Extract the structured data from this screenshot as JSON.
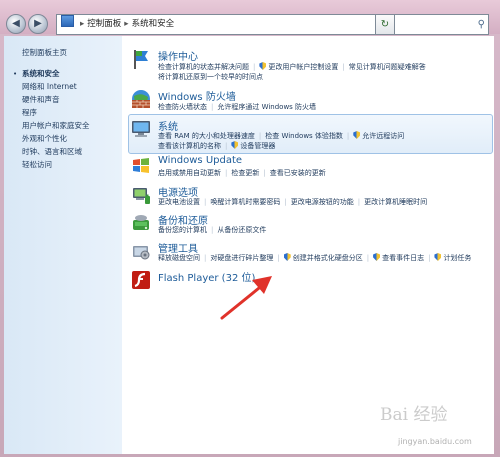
{
  "window": {
    "breadcrumb": [
      "控制面板",
      "系统和安全"
    ],
    "search_placeholder": ""
  },
  "sidebar": {
    "home": "控制面板主页",
    "items": [
      "系统和安全",
      "网络和 Internet",
      "硬件和声音",
      "程序",
      "用户帐户和家庭安全",
      "外观和个性化",
      "时钟、语言和区域",
      "轻松访问"
    ]
  },
  "categories": {
    "action_center": {
      "title": "操作中心",
      "row1": [
        "检查计算机的状态并解决问题",
        "更改用户帐户控制设置",
        "常见计算机问题疑难解答"
      ],
      "row2": [
        "将计算机还原到一个较早的时间点"
      ]
    },
    "firewall": {
      "title": "Windows 防火墙",
      "row1": [
        "检查防火墙状态",
        "允许程序通过 Windows 防火墙"
      ]
    },
    "system": {
      "title": "系统",
      "row1": [
        "查看 RAM 的大小和处理器速度",
        "检查 Windows 体验指数",
        "允许远程访问"
      ],
      "row2": [
        "查看该计算机的名称",
        "设备管理器"
      ]
    },
    "windows_update": {
      "title": "Windows Update",
      "row1": [
        "启用或禁用自动更新",
        "检查更新",
        "查看已安装的更新"
      ]
    },
    "power": {
      "title": "电源选项",
      "row1": [
        "更改电池设置",
        "唤醒计算机时需要密码",
        "更改电源按钮的功能",
        "更改计算机睡眠时间"
      ]
    },
    "backup": {
      "title": "备份和还原",
      "row1": [
        "备份您的计算机",
        "从备份还原文件"
      ]
    },
    "admin_tools": {
      "title": "管理工具",
      "row1": [
        "释放磁盘空间",
        "对硬盘进行碎片整理",
        "创建并格式化硬盘分区",
        "查看事件日志",
        "计划任务"
      ]
    },
    "flash": {
      "title": "Flash Player (32 位)"
    }
  },
  "watermark": {
    "text": "Bai 经验",
    "url": "jingyan.baidu.com"
  },
  "colors": {
    "link": "#1e395b",
    "title": "#1e5c99",
    "annotation_arrow": "#e0322a"
  }
}
